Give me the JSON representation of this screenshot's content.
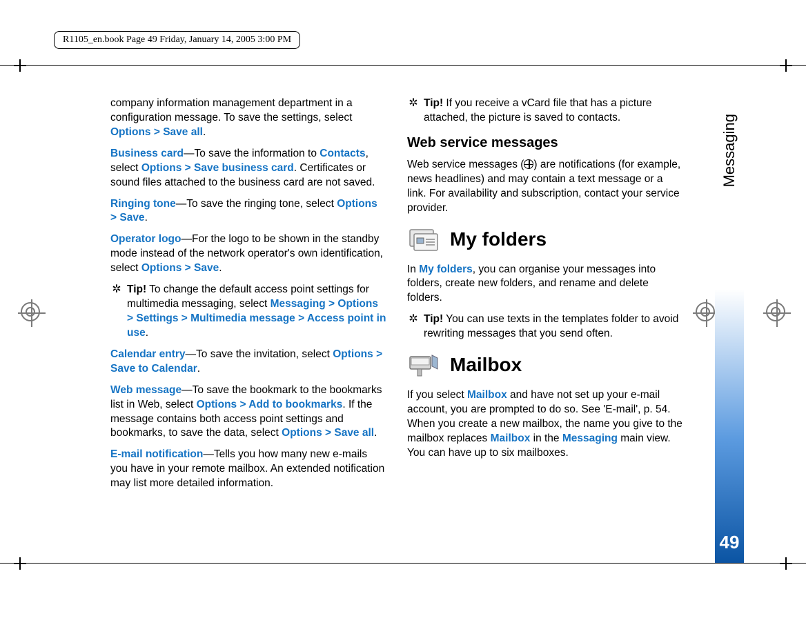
{
  "header": {
    "book_info": "R1105_en.book  Page 49  Friday, January 14, 2005  3:00 PM"
  },
  "side_tab": {
    "label": "Messaging",
    "page_number": "49"
  },
  "left_column": {
    "p1_a": "company information management department in a configuration message. To save the settings, select ",
    "p1_b": "Options > Save all",
    "p1_c": ".",
    "biz_term": "Business card",
    "biz_a": "—To save the information to ",
    "biz_contacts": "Contacts",
    "biz_b": ", select ",
    "biz_opt": "Options > Save business card",
    "biz_c": ". Certificates or sound files attached to the business card are not saved.",
    "ring_term": "Ringing tone",
    "ring_a": "—To save the ringing tone, select ",
    "ring_opt": "Options > Save",
    "ring_b": ".",
    "logo_term": "Operator logo",
    "logo_a": "—For the logo to be shown in the standby mode instead of the network operator's own identification, select ",
    "logo_opt": "Options > Save",
    "logo_b": ".",
    "tip1_label": "Tip!",
    "tip1_a": " To change the default access point settings for multimedia messaging, select ",
    "tip1_opt": "Messaging > Options > Settings > Multimedia message > Access point in use",
    "tip1_b": ".",
    "cal_term": "Calendar entry",
    "cal_a": "—To save the invitation, select ",
    "cal_opt": "Options > Save to Calendar",
    "cal_b": ".",
    "web_term": "Web message",
    "web_a": "—To save the bookmark to the bookmarks list in Web, select ",
    "web_opt1": "Options > Add to bookmarks",
    "web_b": ". If the message contains both access point settings and bookmarks, to save the data, select ",
    "web_opt2": "Options > Save all",
    "web_c": ".",
    "email_term": "E-mail notification",
    "email_a": "—Tells you how many new e-mails you have in your remote mailbox. An extended notification may list more detailed information."
  },
  "right_column": {
    "tip2_label": "Tip!",
    "tip2_a": " If you receive a vCard file that has a picture attached, the picture is saved to contacts.",
    "wsm_heading": "Web service messages",
    "wsm_a": "Web service messages (",
    "wsm_b": ") are notifications (for example, news headlines) and may contain a text message or a link. For availability and subscription, contact your service provider.",
    "myfolders_heading": "My folders",
    "myfolders_a": "In ",
    "myfolders_link": "My folders",
    "myfolders_b": ", you can organise your messages into folders, create new folders, and rename and delete folders.",
    "tip3_label": "Tip!",
    "tip3_a": " You can use texts in the templates folder to avoid rewriting messages that you send often.",
    "mailbox_heading": "Mailbox",
    "mailbox_a": "If you select ",
    "mailbox_link1": "Mailbox",
    "mailbox_b": " and have not set up your e-mail account, you are prompted to do so. See 'E-mail', p. 54. When you create a new mailbox, the name you give to the mailbox replaces ",
    "mailbox_link2": "Mailbox",
    "mailbox_c": " in the ",
    "mailbox_link3": "Messaging",
    "mailbox_d": " main view. You can have up to six mailboxes."
  }
}
